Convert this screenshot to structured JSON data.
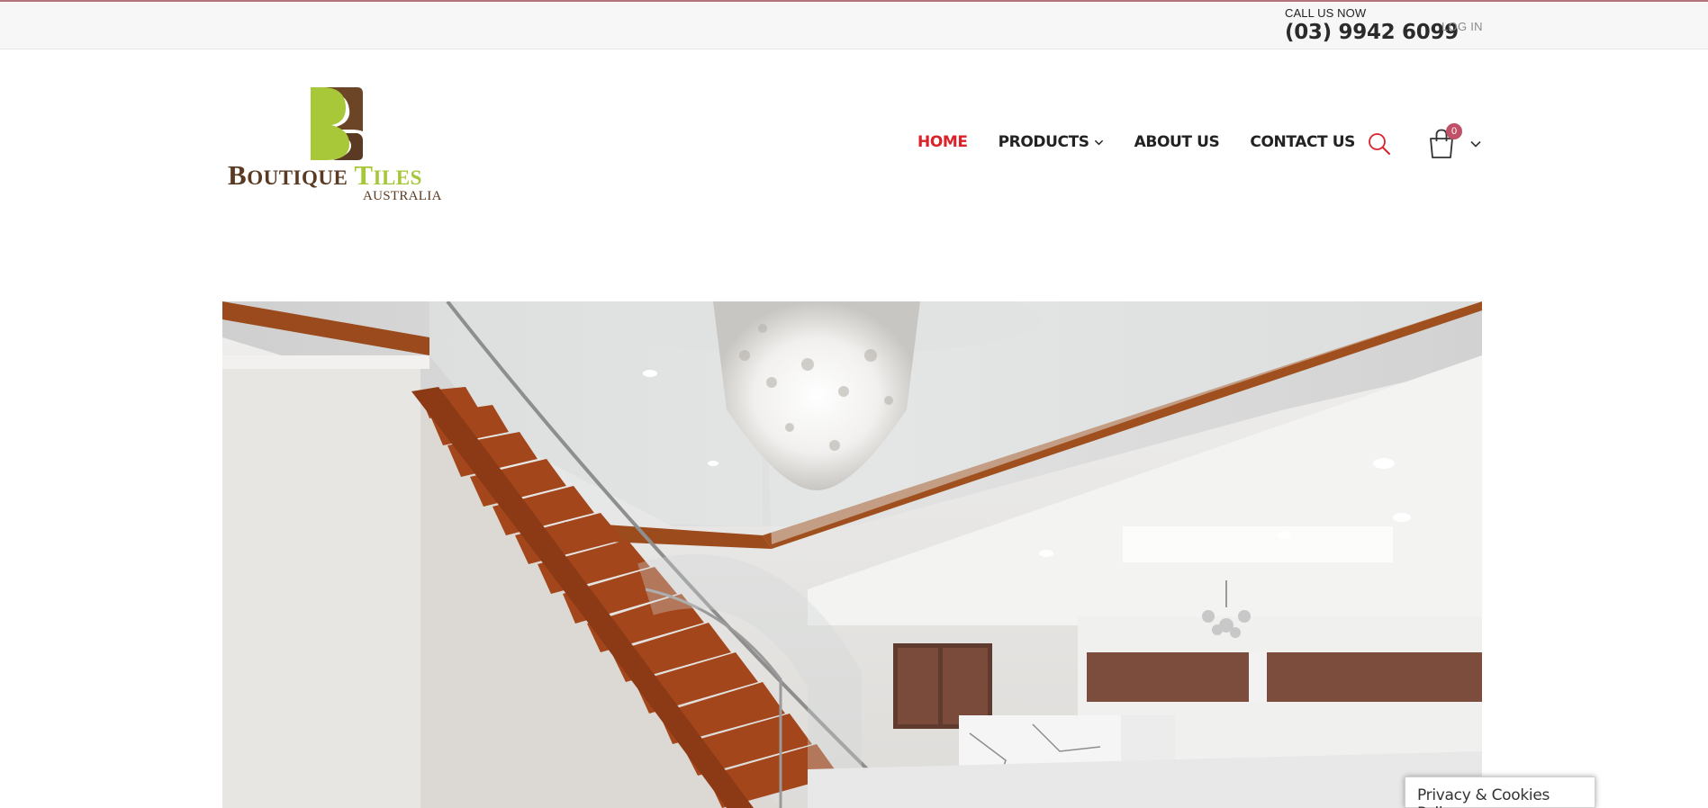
{
  "topbar": {
    "call_label": "CALL US NOW",
    "phone": "(03) 9942 6099",
    "login_label": "LOG IN"
  },
  "logo": {
    "line1": "BOUTIQUE TILES",
    "line2": "AUSTRALIA",
    "letter_color_green": "#a6c739",
    "letter_color_brown": "#5a3a22"
  },
  "nav": {
    "items": [
      {
        "label": "HOME",
        "active": true
      },
      {
        "label": "PRODUCTS",
        "has_dropdown": true
      },
      {
        "label": "ABOUT US"
      },
      {
        "label": "CONTACT US"
      }
    ],
    "active_color": "#d9222a"
  },
  "cart": {
    "count": "0",
    "icon": "shopping-bag-icon"
  },
  "search": {
    "icon": "search-icon"
  },
  "privacy": {
    "label": "Privacy & Cookies Policy"
  }
}
